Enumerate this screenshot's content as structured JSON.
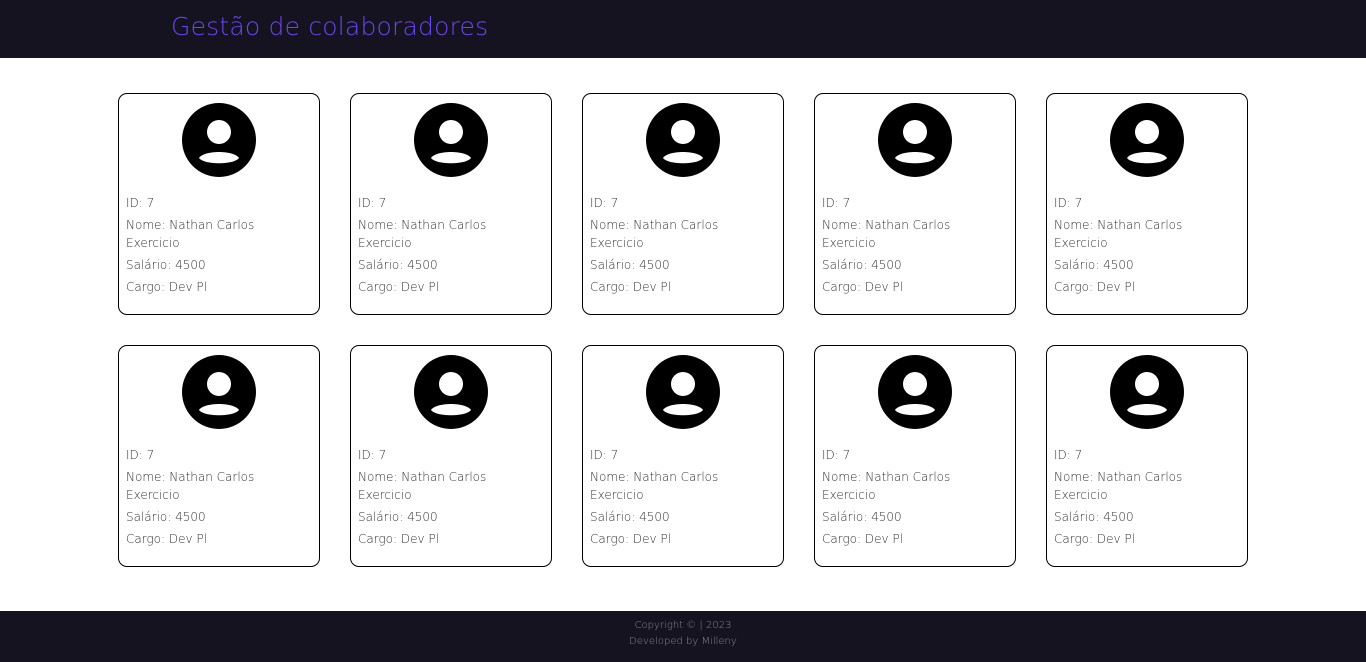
{
  "header": {
    "title": "Gestão de colaboradores"
  },
  "colors": {
    "header_bg": "#15131f",
    "title": "#6a45f2",
    "card_border": "#000000"
  },
  "cards": [
    {
      "icon": "user-circle-icon",
      "id": "ID: 7",
      "nome": "Nome: Nathan Carlos Exercicio",
      "salario": "Salário: 4500",
      "cargo": "Cargo: Dev Pl"
    },
    {
      "icon": "user-circle-icon",
      "id": "ID: 7",
      "nome": "Nome: Nathan Carlos Exercicio",
      "salario": "Salário: 4500",
      "cargo": "Cargo: Dev Pl"
    },
    {
      "icon": "user-circle-icon",
      "id": "ID: 7",
      "nome": "Nome: Nathan Carlos Exercicio",
      "salario": "Salário: 4500",
      "cargo": "Cargo: Dev Pl"
    },
    {
      "icon": "user-circle-icon",
      "id": "ID: 7",
      "nome": "Nome: Nathan Carlos Exercicio",
      "salario": "Salário: 4500",
      "cargo": "Cargo: Dev Pl"
    },
    {
      "icon": "user-circle-icon",
      "id": "ID: 7",
      "nome": "Nome: Nathan Carlos Exercicio",
      "salario": "Salário: 4500",
      "cargo": "Cargo: Dev Pl"
    },
    {
      "icon": "user-circle-icon",
      "id": "ID: 7",
      "nome": "Nome: Nathan Carlos Exercicio",
      "salario": "Salário: 4500",
      "cargo": "Cargo: Dev Pl"
    },
    {
      "icon": "user-circle-icon",
      "id": "ID: 7",
      "nome": "Nome: Nathan Carlos Exercicio",
      "salario": "Salário: 4500",
      "cargo": "Cargo: Dev Pl"
    },
    {
      "icon": "user-circle-icon",
      "id": "ID: 7",
      "nome": "Nome: Nathan Carlos Exercicio",
      "salario": "Salário: 4500",
      "cargo": "Cargo: Dev Pl"
    },
    {
      "icon": "user-circle-icon",
      "id": "ID: 7",
      "nome": "Nome: Nathan Carlos Exercicio",
      "salario": "Salário: 4500",
      "cargo": "Cargo: Dev Pl"
    },
    {
      "icon": "user-circle-icon",
      "id": "ID: 7",
      "nome": "Nome: Nathan Carlos Exercicio",
      "salario": "Salário: 4500",
      "cargo": "Cargo: Dev Pl"
    }
  ],
  "footer": {
    "copyright": "Copyright © | 2023",
    "developer": "Developed by Milleny"
  }
}
